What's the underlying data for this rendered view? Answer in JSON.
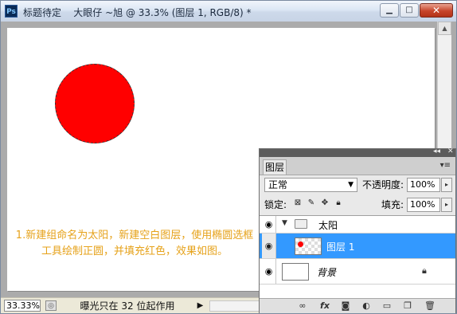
{
  "window": {
    "title": "标题待定    大眼仔 ~旭 @ 33.3% (图层 1, RGB/8) *",
    "app_icon": "Ps",
    "controls": {
      "minimize": "▁",
      "maximize": "□",
      "close": "✕"
    }
  },
  "canvas": {
    "instruction": "1.新建组命名为太阳，新建空白图层，使用椭圆选框工具绘制正圆，并填充红色，效果如图。",
    "shape_color": "#ff0000",
    "instruction_color": "#e6a21a"
  },
  "statusbar": {
    "zoom": "33.33%",
    "message": "曝光只在 32 位起作用",
    "arrow": "▶"
  },
  "layers_panel": {
    "tab": "图层",
    "blend_mode": "正常",
    "opacity_label": "不透明度:",
    "opacity_value": "100%",
    "lock_label": "锁定:",
    "fill_label": "填充:",
    "fill_value": "100%",
    "layers": [
      {
        "name": "太阳",
        "type": "group",
        "expanded": true
      },
      {
        "name": "图层 1",
        "type": "layer",
        "selected": true
      },
      {
        "name": "背景",
        "type": "background",
        "locked": true
      }
    ],
    "selected_color": "#3399ff"
  }
}
